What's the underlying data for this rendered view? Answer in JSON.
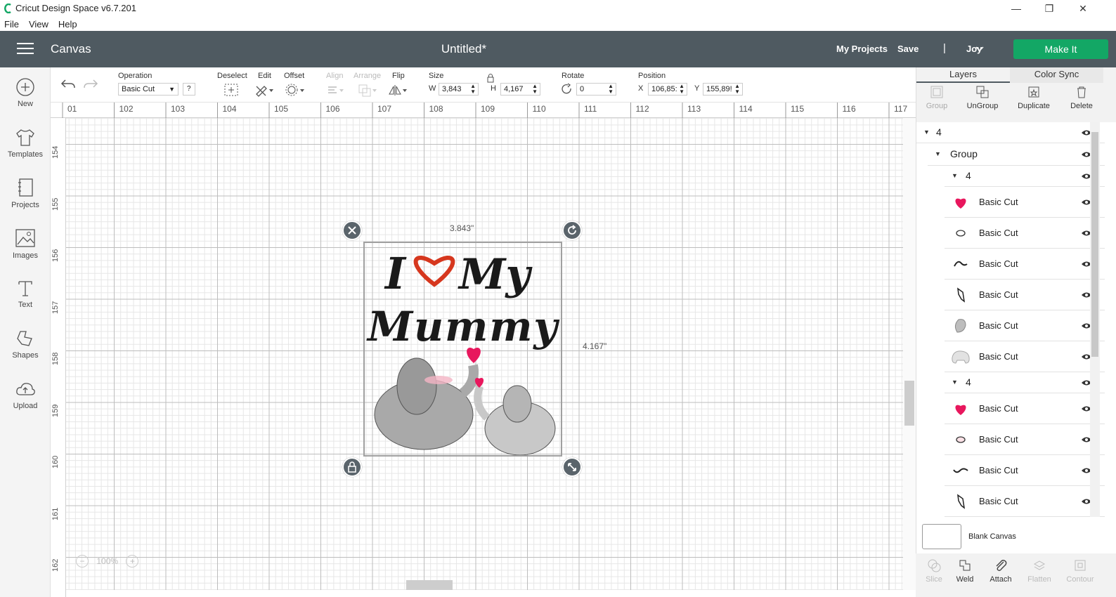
{
  "window": {
    "title": "Cricut Design Space  v6.7.201",
    "minimize": "—",
    "maximize": "❐",
    "close": "✕"
  },
  "menu": [
    "File",
    "View",
    "Help"
  ],
  "header": {
    "section": "Canvas",
    "doc_title": "Untitled*",
    "my_projects": "My Projects",
    "save": "Save",
    "separator": "|",
    "user": "Joy",
    "make_it": "Make It"
  },
  "leftbar": [
    "New",
    "Templates",
    "Projects",
    "Images",
    "Text",
    "Shapes",
    "Upload"
  ],
  "toolbar": {
    "operation_label": "Operation",
    "operation_value": "Basic Cut",
    "help": "?",
    "deselect": "Deselect",
    "edit": "Edit",
    "offset": "Offset",
    "align": "Align",
    "arrange": "Arrange",
    "flip": "Flip",
    "size_label": "Size",
    "w_label": "W",
    "w_value": "3,843",
    "h_label": "H",
    "h_value": "4,167",
    "rotate_label": "Rotate",
    "rotate_value": "0",
    "position_label": "Position",
    "x_label": "X",
    "x_value": "106,85:",
    "y_label": "Y",
    "y_value": "155,89!"
  },
  "ruler_top": [
    "01",
    "102",
    "103",
    "104",
    "105",
    "106",
    "107",
    "108",
    "109",
    "110",
    "111",
    "112",
    "113",
    "114",
    "115",
    "116",
    "117"
  ],
  "ruler_left": [
    "154",
    "155",
    "156",
    "157",
    "158",
    "159",
    "160",
    "161",
    "162"
  ],
  "canvas": {
    "width_label": "3.843\"",
    "height_label": "4.167\"",
    "zoom": "100%",
    "design_line1_a": "I",
    "design_line1_b": "My",
    "design_line2": "Mummy",
    "colors": {
      "heart": "#e8175d",
      "outline_heart": "#d6371e",
      "elephant": "#a9a9a9",
      "baby": "#c8c8c8"
    }
  },
  "panel": {
    "tab_layers": "Layers",
    "tab_color_sync": "Color Sync",
    "actions": [
      "Group",
      "UnGroup",
      "Duplicate",
      "Delete"
    ],
    "layers": [
      {
        "label": "4",
        "kind": "group0"
      },
      {
        "label": "Group",
        "kind": "group1"
      },
      {
        "label": "4",
        "kind": "group2"
      },
      {
        "label": "Basic Cut",
        "icon": "heart-icon"
      },
      {
        "label": "Basic Cut",
        "icon": "oval-icon"
      },
      {
        "label": "Basic Cut",
        "icon": "curve-icon"
      },
      {
        "label": "Basic Cut",
        "icon": "trunk-icon"
      },
      {
        "label": "Basic Cut",
        "icon": "ear-icon"
      },
      {
        "label": "Basic Cut",
        "icon": "elephant-icon"
      },
      {
        "label": "4",
        "kind": "group2"
      },
      {
        "label": "Basic Cut",
        "icon": "heart-icon"
      },
      {
        "label": "Basic Cut",
        "icon": "oval-pink-icon"
      },
      {
        "label": "Basic Cut",
        "icon": "wave-icon"
      },
      {
        "label": "Basic Cut",
        "icon": "trunk-icon"
      }
    ],
    "blank_canvas": "Blank Canvas",
    "bottom": [
      "Slice",
      "Weld",
      "Attach",
      "Flatten",
      "Contour"
    ]
  }
}
